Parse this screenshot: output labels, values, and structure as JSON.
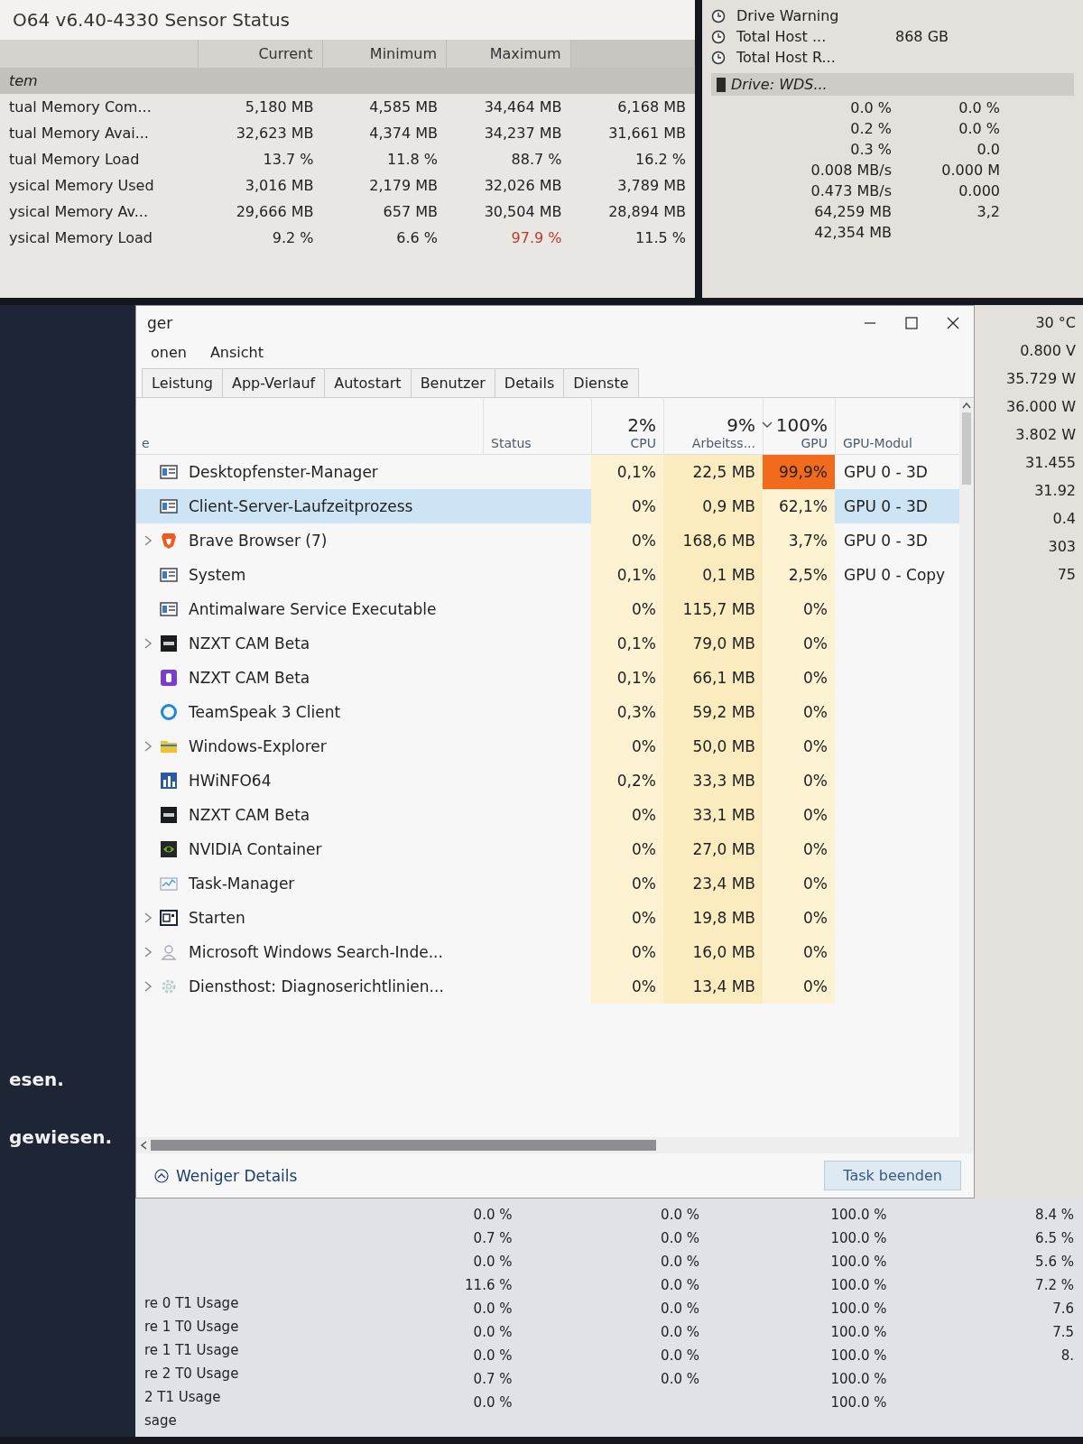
{
  "sensor_window": {
    "title": "O64 v6.40-4330 Sensor Status",
    "columns": [
      "Current",
      "Minimum",
      "Maximum"
    ],
    "rows": [
      {
        "kind": "group",
        "label": "tem"
      },
      {
        "kind": "sensor",
        "label": "tual Memory Com...",
        "values": [
          {
            "text": "5,180 MB",
            "alert": false
          },
          {
            "text": "4,585 MB",
            "alert": false
          },
          {
            "text": "34,464 MB",
            "alert": false
          },
          {
            "text": "6,168 MB",
            "alert": false
          }
        ]
      },
      {
        "kind": "sensor",
        "label": "tual Memory Avai...",
        "values": [
          {
            "text": "32,623 MB",
            "alert": false
          },
          {
            "text": "4,374 MB",
            "alert": false
          },
          {
            "text": "34,237 MB",
            "alert": false
          },
          {
            "text": "31,661 MB",
            "alert": false
          }
        ]
      },
      {
        "kind": "sensor",
        "label": "tual Memory Load",
        "values": [
          {
            "text": "13.7 %",
            "alert": false
          },
          {
            "text": "11.8 %",
            "alert": false
          },
          {
            "text": "88.7 %",
            "alert": false
          },
          {
            "text": "16.2 %",
            "alert": false
          }
        ]
      },
      {
        "kind": "sensor",
        "label": "ysical Memory Used",
        "values": [
          {
            "text": "3,016 MB",
            "alert": false
          },
          {
            "text": "2,179 MB",
            "alert": false
          },
          {
            "text": "32,026 MB",
            "alert": false
          },
          {
            "text": "3,789 MB",
            "alert": false
          }
        ]
      },
      {
        "kind": "sensor",
        "label": "ysical Memory Av...",
        "values": [
          {
            "text": "29,666 MB",
            "alert": false
          },
          {
            "text": "657 MB",
            "alert": false
          },
          {
            "text": "30,504 MB",
            "alert": false
          },
          {
            "text": "28,894 MB",
            "alert": false
          }
        ]
      },
      {
        "kind": "sensor",
        "label": "ysical Memory Load",
        "values": [
          {
            "text": "9.2 %",
            "alert": false
          },
          {
            "text": "6.6 %",
            "alert": false
          },
          {
            "text": "97.9 %",
            "alert": true
          },
          {
            "text": "11.5 %",
            "alert": false
          }
        ]
      }
    ]
  },
  "drive_panel": {
    "items": [
      {
        "label": "Drive Warning"
      },
      {
        "label": "Total Host ...",
        "value": "868 GB"
      },
      {
        "label": "Total Host R..."
      }
    ],
    "drive_header": "Drive: WDS...",
    "rows": [
      [
        "0.0 %",
        "0.0 %"
      ],
      [
        "0.2 %",
        "0.0 %"
      ],
      [
        "0.3 %",
        "0.0"
      ],
      [
        "0.008 MB/s",
        "0.000 M"
      ],
      [
        "0.473 MB/s",
        "0.000"
      ],
      [
        "64,259 MB",
        "3,2"
      ],
      [
        "42,354 MB"
      ]
    ],
    "more_values": [
      "30 °C",
      "0.800 V",
      "35.729 W",
      "36.000 W",
      "3.802 W",
      "31.455",
      "31.92",
      "0.4",
      "303",
      "75"
    ]
  },
  "side_messages": [
    "esen.",
    "gewiesen."
  ],
  "task_manager": {
    "title": "ger",
    "menu": [
      "onen",
      "Ansicht"
    ],
    "tabs": [
      {
        "label": "Leistung",
        "selected": false
      },
      {
        "label": "App-Verlauf",
        "selected": false
      },
      {
        "label": "Autostart",
        "selected": false
      },
      {
        "label": "Benutzer",
        "selected": false
      },
      {
        "label": "Details",
        "selected": false
      },
      {
        "label": "Dienste",
        "selected": false
      }
    ],
    "name_column": "e",
    "columns": [
      {
        "label": "Status",
        "sorted": false
      },
      {
        "percent": "2%",
        "label": "CPU",
        "sorted": false
      },
      {
        "percent": "9%",
        "label": "Arbeitss...",
        "sorted": false
      },
      {
        "percent": "100%",
        "label": "GPU",
        "sorted": true
      },
      {
        "label": "GPU-Modul",
        "sorted": false
      }
    ],
    "processes": [
      {
        "name": "Desktopfenster-Manager",
        "kind": "window",
        "expandable": false,
        "selected": false,
        "cpu": "0,1%",
        "memory": "22,5 MB",
        "gpu": "99,9%",
        "gpu_hot": true,
        "gpu_engine": "GPU 0 - 3D"
      },
      {
        "name": "Client-Server-Laufzeitprozess",
        "kind": "window",
        "expandable": false,
        "selected": true,
        "cpu": "0%",
        "memory": "0,9 MB",
        "gpu": "62,1%",
        "gpu_hot": false,
        "gpu_engine": "GPU 0 - 3D"
      },
      {
        "name": "Brave Browser (7)",
        "kind": "shield",
        "expandable": true,
        "selected": false,
        "cpu": "0%",
        "memory": "168,6 MB",
        "gpu": "3,7%",
        "gpu_hot": false,
        "gpu_engine": "GPU 0 - 3D"
      },
      {
        "name": "System",
        "kind": "window",
        "expandable": false,
        "selected": false,
        "cpu": "0,1%",
        "memory": "0,1 MB",
        "gpu": "2,5%",
        "gpu_hot": false,
        "gpu_engine": "GPU 0 - Copy"
      },
      {
        "name": "Antimalware Service Executable",
        "kind": "window",
        "expandable": false,
        "selected": false,
        "cpu": "0%",
        "memory": "115,7 MB",
        "gpu": "0%",
        "gpu_hot": false
      },
      {
        "name": "NZXT CAM Beta",
        "kind": "dark",
        "expandable": true,
        "selected": false,
        "cpu": "0,1%",
        "memory": "79,0 MB",
        "gpu": "0%",
        "gpu_hot": false
      },
      {
        "name": "NZXT CAM Beta",
        "kind": "purple",
        "expandable": false,
        "selected": false,
        "cpu": "0,1%",
        "memory": "66,1 MB",
        "gpu": "0%",
        "gpu_hot": false
      },
      {
        "name": "TeamSpeak 3 Client",
        "kind": "ring",
        "expandable": false,
        "selected": false,
        "cpu": "0,3%",
        "memory": "59,2 MB",
        "gpu": "0%",
        "gpu_hot": false
      },
      {
        "name": "Windows-Explorer",
        "kind": "folder",
        "expandable": true,
        "selected": false,
        "cpu": "0%",
        "memory": "50,0 MB",
        "gpu": "0%",
        "gpu_hot": false
      },
      {
        "name": "HWiNFO64",
        "kind": "bars",
        "expandable": false,
        "selected": false,
        "cpu": "0,2%",
        "memory": "33,3 MB",
        "gpu": "0%",
        "gpu_hot": false
      },
      {
        "name": "NZXT CAM Beta",
        "kind": "dark",
        "expandable": false,
        "selected": false,
        "cpu": "0%",
        "memory": "33,1 MB",
        "gpu": "0%",
        "gpu_hot": false
      },
      {
        "name": "NVIDIA Container",
        "kind": "swirl",
        "expandable": false,
        "selected": false,
        "cpu": "0%",
        "memory": "27,0 MB",
        "gpu": "0%",
        "gpu_hot": false
      },
      {
        "name": "Task-Manager",
        "kind": "chart",
        "expandable": false,
        "selected": false,
        "cpu": "0%",
        "memory": "23,4 MB",
        "gpu": "0%",
        "gpu_hot": false
      },
      {
        "name": "Starten",
        "kind": "frame",
        "expandable": true,
        "selected": false,
        "cpu": "0%",
        "memory": "19,8 MB",
        "gpu": "0%",
        "gpu_hot": false
      },
      {
        "name": "Microsoft Windows Search-Inde...",
        "kind": "user",
        "expandable": true,
        "selected": false,
        "cpu": "0%",
        "memory": "16,0 MB",
        "gpu": "0%",
        "gpu_hot": false
      },
      {
        "name": "Diensthost: Diagnoserichtlinien...",
        "kind": "gear",
        "expandable": true,
        "selected": false,
        "cpu": "0%",
        "memory": "13,4 MB",
        "gpu": "0%",
        "gpu_hot": false
      }
    ],
    "fewer_details": "Weniger Details",
    "end_task": "Task beenden"
  },
  "core_usage": {
    "labels": [
      "re 0 T1 Usage",
      "re 1 T0 Usage",
      "re 1 T1 Usage",
      "re 2 T0 Usage",
      "2 T1 Usage",
      "sage"
    ],
    "columns": [
      [
        "0.0 %",
        "0.7 %",
        "0.0 %",
        "11.6 %",
        "0.0 %",
        "0.0 %",
        "0.0 %",
        "0.7 %",
        "0.0 %"
      ],
      [
        "0.0 %",
        "0.0 %",
        "0.0 %",
        "0.0 %",
        "0.0 %",
        "0.0 %",
        "0.0 %",
        "0.0 %"
      ],
      [
        "100.0 %",
        "100.0 %",
        "100.0 %",
        "100.0 %",
        "100.0 %",
        "100.0 %",
        "100.0 %",
        "100.0 %",
        "100.0 %"
      ],
      [
        "8.4 %",
        "6.5 %",
        "5.6 %",
        "7.2 %",
        "7.6",
        "7.5",
        "8."
      ]
    ]
  }
}
